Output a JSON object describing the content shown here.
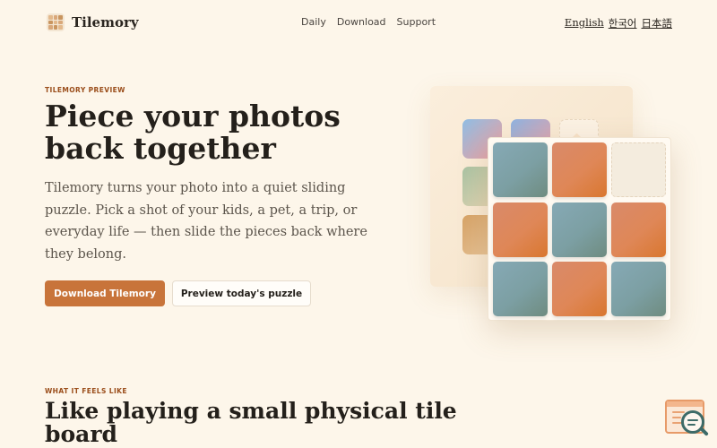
{
  "header": {
    "brand": "Tilemory",
    "nav": [
      "Daily",
      "Download",
      "Support"
    ],
    "languages": [
      "English",
      "한국어",
      "日本語"
    ]
  },
  "hero": {
    "eyebrow": "TILEMORY PREVIEW",
    "title": "Piece your photos back together",
    "description": "Tilemory turns your photo into a quiet sliding puzzle. Pick a shot of your kids, a pet, a trip, or everyday life — then slide the pieces back where they belong.",
    "primary_button": "Download Tilemory",
    "secondary_button": "Preview today's puzzle"
  },
  "section": {
    "eyebrow": "WHAT IT FEELS LIKE",
    "title": "Like playing a small physical tile board"
  },
  "colors": {
    "background": "#fdf6ea",
    "accent": "#c8743a",
    "eyebrow": "#9a4d1a",
    "tile_teal": "#7c9fa3",
    "tile_orange": "#df8757"
  },
  "icons": {
    "logo": "tile-grid-logo",
    "help_widget": "help-search-icon"
  }
}
